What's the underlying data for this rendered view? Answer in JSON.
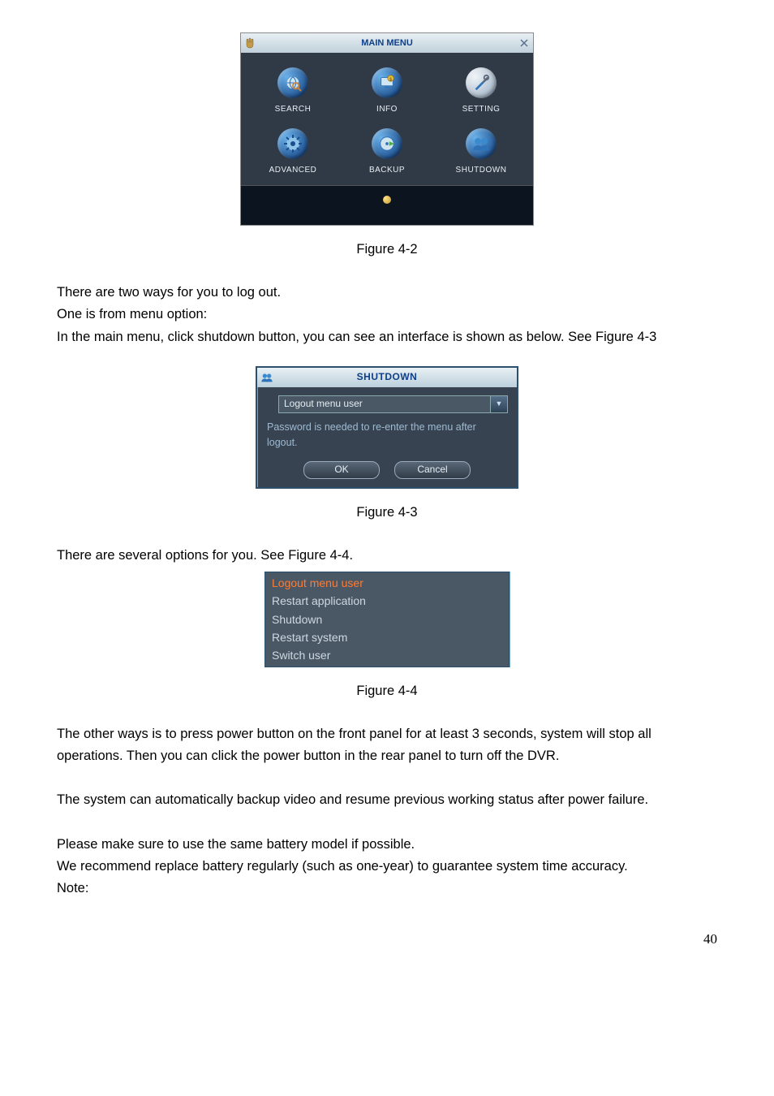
{
  "fig42": {
    "title": "MAIN MENU",
    "items": [
      {
        "label": "SEARCH",
        "icon": "globe-search"
      },
      {
        "label": "INFO",
        "icon": "monitor-info"
      },
      {
        "label": "SETTING",
        "icon": "tools"
      },
      {
        "label": "ADVANCED",
        "icon": "gear"
      },
      {
        "label": "BACKUP",
        "icon": "disc-play"
      },
      {
        "label": "SHUTDOWN",
        "icon": "users"
      }
    ],
    "caption": "Figure 4-2"
  },
  "text": {
    "p1": "There are two ways for you to log out.",
    "p2": "One is from menu option:",
    "p3": "In the main menu, click shutdown button, you can see an interface is shown as below.  See Figure 4-3",
    "p4": "There are several options for you. See Figure 4-4.",
    "p5": "The other ways is to press power button on the front panel for at least 3 seconds, system will stop all operations. Then you can click the power button in the rear panel to turn off the DVR.",
    "p6": "The system can automatically backup video and resume previous working status after power failure.",
    "p7": "Please make sure to use the same battery model if possible.",
    "p8": "We recommend replace battery regularly (such as one-year) to guarantee system time accuracy.",
    "p9": "Note:"
  },
  "fig43": {
    "title": "SHUTDOWN",
    "select_value": "Logout menu user",
    "message": "Password is needed to re-enter the menu after logout.",
    "ok": "OK",
    "cancel": "Cancel",
    "caption": "Figure 4-3"
  },
  "fig44": {
    "options": [
      "Logout menu user",
      "Restart application",
      "Shutdown",
      "Restart system",
      "Switch user"
    ],
    "selected_index": 0,
    "caption": "Figure 4-4"
  },
  "page_number": "40"
}
